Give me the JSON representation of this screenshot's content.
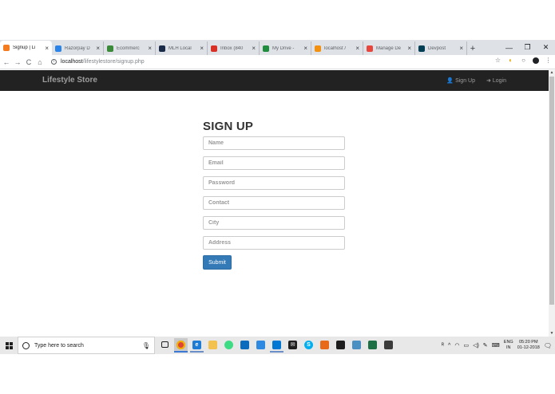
{
  "browser": {
    "tabs": [
      {
        "label": "Signup | Li",
        "favicon": "lifestyle-favicon",
        "color": "#f47b20",
        "active": true
      },
      {
        "label": "Razorpay D",
        "favicon": "razorpay-favicon",
        "color": "#2b84ea",
        "active": false
      },
      {
        "label": "Ecommerc",
        "favicon": "ecommerce-favicon",
        "color": "#3a8a3a",
        "active": false
      },
      {
        "label": "MLH Local",
        "favicon": "mlh-favicon",
        "color": "#1a2b4a",
        "active": false
      },
      {
        "label": "Inbox (840",
        "favicon": "gmail-favicon",
        "color": "#d93025",
        "active": false
      },
      {
        "label": "My Drive -",
        "favicon": "drive-favicon",
        "color": "#1e8e3e",
        "active": false
      },
      {
        "label": "localhost /",
        "favicon": "phpmyadmin-favicon",
        "color": "#f29111",
        "active": false
      },
      {
        "label": "Manage De",
        "favicon": "manage-favicon",
        "color": "#e8453c",
        "active": false
      },
      {
        "label": "Devpost",
        "favicon": "devpost-favicon",
        "color": "#003e54",
        "active": false
      }
    ],
    "new_tab": "+",
    "window_controls": {
      "minimize": "—",
      "maximize": "❐",
      "close": "✕"
    },
    "url": {
      "host": "localhost",
      "path": "/lifestylestore/signup.php"
    },
    "nav": {
      "back": "←",
      "forward": "→",
      "reload": "C",
      "home": "⌂"
    },
    "toolbar_icons": {
      "star": "☆",
      "ext1": "◐",
      "ext2": "○",
      "menu": "⋮"
    }
  },
  "site": {
    "brand": "Lifestyle Store",
    "nav_links": [
      {
        "label": "Sign Up",
        "icon": "user-icon",
        "glyph": "👤"
      },
      {
        "label": "Login",
        "icon": "login-icon",
        "glyph": "➜"
      }
    ]
  },
  "form": {
    "title": "SIGN UP",
    "fields": [
      {
        "name": "name-input",
        "placeholder": "Name",
        "type": "text"
      },
      {
        "name": "email-input",
        "placeholder": "Email",
        "type": "email"
      },
      {
        "name": "password-input",
        "placeholder": "Password",
        "type": "password"
      },
      {
        "name": "contact-input",
        "placeholder": "Contact",
        "type": "text"
      },
      {
        "name": "city-input",
        "placeholder": "City",
        "type": "text"
      },
      {
        "name": "address-input",
        "placeholder": "Address",
        "type": "text"
      }
    ],
    "submit_label": "Submit",
    "accent_color": "#337ab7"
  },
  "taskbar": {
    "search_placeholder": "Type here to search",
    "language": {
      "line1": "ENG",
      "line2": "IN"
    },
    "clock": {
      "time": "05:20 PM",
      "date": "01-12-2018"
    }
  }
}
